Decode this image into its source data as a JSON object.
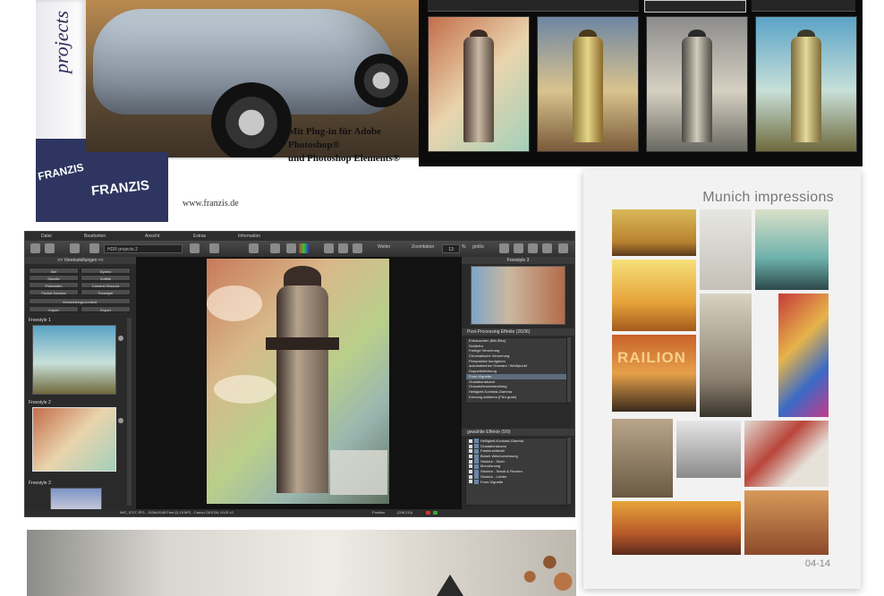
{
  "product_box": {
    "title_fragment": "projects",
    "plugin_line1": "Mit Plug-in für Adobe Photoshop®",
    "plugin_line2": "und Photoshop Elements®",
    "brand_spine": "FRANZIS",
    "brand_front": "FRANZIS",
    "url": "www.franzis.de"
  },
  "app": {
    "menu": [
      "Datei",
      "Bearbeiten",
      "Ansicht",
      "Extras",
      "Information"
    ],
    "toolbar": {
      "preset_select": "HDR projects 2",
      "zoom_label": "Zoomfaktor",
      "zoom_value": "13",
      "zoom_unit": "%",
      "size_label": "größe",
      "weiter_label": "Weiter"
    },
    "left_panel": {
      "header": ">> Voreinstellungen <<",
      "tags": [
        "Alle",
        "Dyamo",
        "Seeelte",
        "Sofflite",
        "Polaroiden",
        "Camera Obscura",
        "Pocket Kamera",
        "Freestyle"
      ],
      "user_presets": "Verwendungs-kontext",
      "import_label": "Import",
      "export_label": "Export",
      "styles": [
        "Freestyle 1",
        "Freestyle 2",
        "Freestyle 3"
      ]
    },
    "right_panel": {
      "preview_header": "Freestyle 3",
      "post_header": "Post-Processing Effekte (26/36)",
      "post_items": [
        "Entrauschen (Bitr./Blur)",
        "Schärfen",
        "Farbige Verzerrung",
        "Chromatische Verzerrung",
        "Perspektive korrigieren",
        "automatischen Schwarz / Weißpunkt",
        "Doppelbelichtung",
        "Form-Vignette",
        "Gradationskurve",
        "Graustufenumwandlung",
        "Helligkeit-Kontrast-Gamma",
        "Körnung addieren (Film grain)"
      ],
      "post_selected_index": 7,
      "chosen_header": "gewählte Effekte (9/9)",
      "chosen_items": [
        "Helligkeit-Kontrast-Gamma",
        "Gradationskurve",
        "Farbleuchtkraft",
        "Bokeh Weichzeichnung",
        "Struktur - Stein",
        "Monotonung",
        "Struktur - Staub & Flecken",
        "Struktur - Lichter",
        "Form-Vignette"
      ]
    },
    "statusbar": {
      "left": "IMG_5707.JPG - 1536x2048 Pixel (3,15 MP) - Canon DIGITAL IXUS v3",
      "position_label": "Position",
      "position_value": "(296,210)"
    }
  },
  "collage": {
    "title": "Munich impressions",
    "page": "04-14",
    "railway_sign": "RAILION"
  },
  "colors": {
    "app_bg": "#1e1e1e",
    "panel_bg": "#2a2a2a",
    "box_navy": "#2e3560",
    "selection": "#5d6d7d"
  }
}
